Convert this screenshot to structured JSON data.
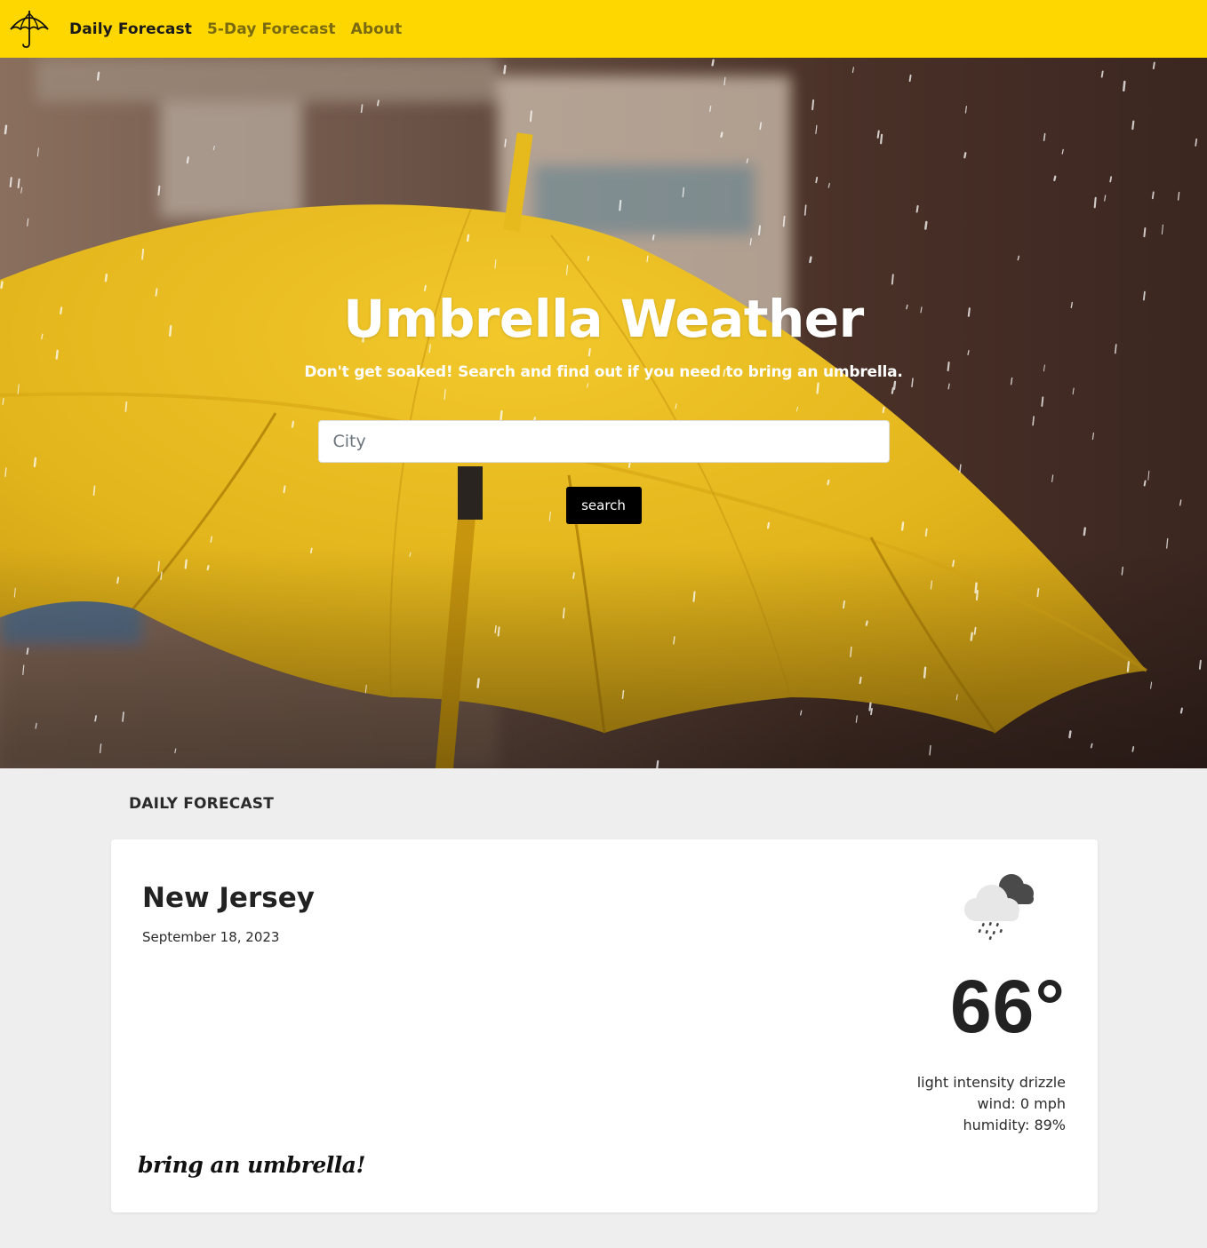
{
  "navbar": {
    "logo_icon": "umbrella-icon",
    "background": "#ffd700",
    "links": [
      {
        "label": "Daily Forecast",
        "active": true
      },
      {
        "label": "5-Day Forecast",
        "active": false
      },
      {
        "label": "About",
        "active": false
      }
    ]
  },
  "hero": {
    "title": "Umbrella Weather",
    "subtitle": "Don't get soaked! Search and find out if you need to bring an umbrella.",
    "search": {
      "placeholder": "City",
      "value": ""
    },
    "search_button": "search"
  },
  "forecast": {
    "section_heading": "DAILY FORECAST",
    "city": "New Jersey",
    "date": "September 18, 2023",
    "weather_icon": "rain-cloud-icon",
    "temperature": "66°",
    "description": "light intensity drizzle",
    "wind": "wind: 0 mph",
    "humidity": "humidity: 89%",
    "note": "bring an umbrella!"
  }
}
